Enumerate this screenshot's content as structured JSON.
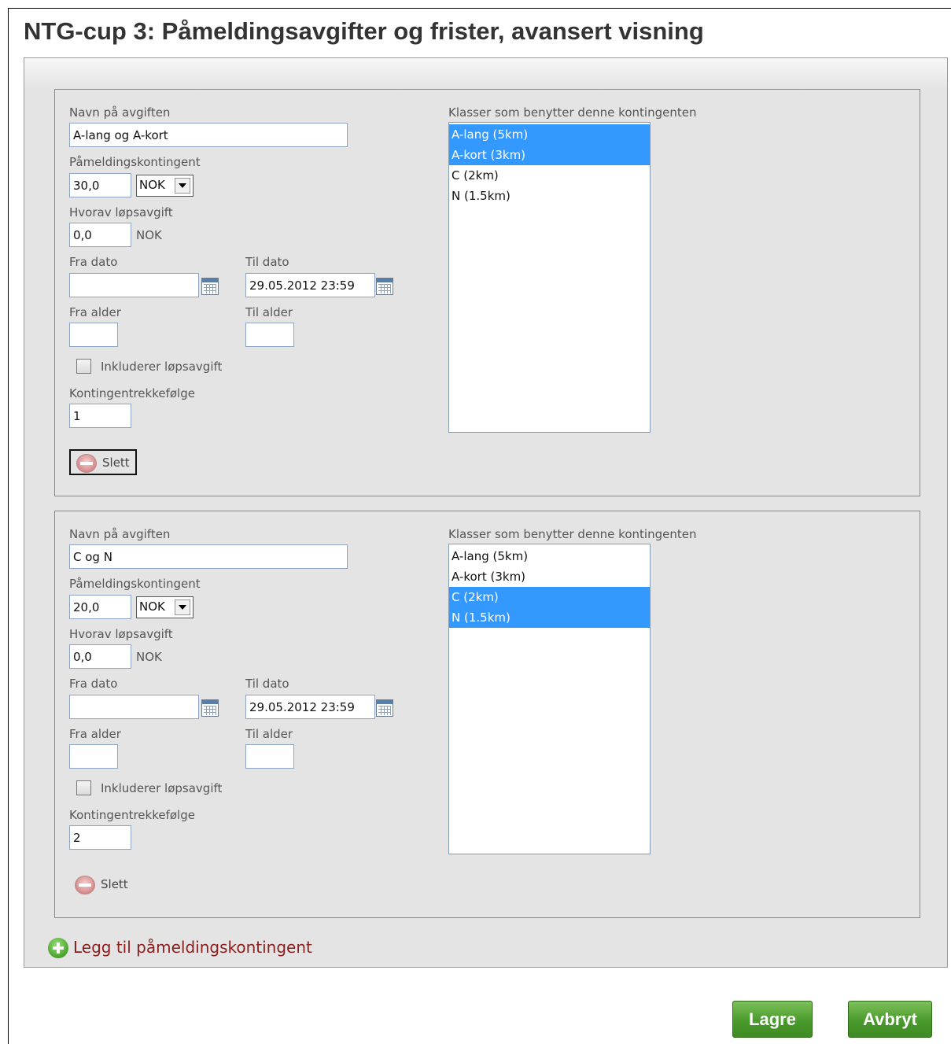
{
  "page": {
    "title": "NTG-cup 3: Påmeldingsavgifter og frister, avansert visning"
  },
  "labels": {
    "fee_name": "Navn på avgiften",
    "entry_fee": "Påmeldingskontingent",
    "of_which_race_fee": "Hvorav løpsavgift",
    "from_date": "Fra dato",
    "to_date": "Til dato",
    "from_age": "Fra alder",
    "to_age": "Til alder",
    "includes_race_fee": "Inkluderer løpsavgift",
    "fee_order": "Kontingentrekkefølge",
    "classes": "Klasser som benytter denne kontingenten",
    "delete": "Slett",
    "currency_unit": "NOK"
  },
  "fees": [
    {
      "name": "A-lang og A-kort",
      "amount": "30,0",
      "currency": "NOK",
      "race_fee": "0,0",
      "from_date": "",
      "to_date": "29.05.2012 23:59",
      "from_age": "",
      "to_age": "",
      "includes_race_fee": false,
      "order": "1",
      "classes": [
        {
          "label": "A-lang (5km)",
          "selected": true
        },
        {
          "label": "A-kort (3km)",
          "selected": true
        },
        {
          "label": "C (2km)",
          "selected": false
        },
        {
          "label": "N (1.5km)",
          "selected": false
        }
      ]
    },
    {
      "name": "C og N",
      "amount": "20,0",
      "currency": "NOK",
      "race_fee": "0,0",
      "from_date": "",
      "to_date": "29.05.2012 23:59",
      "from_age": "",
      "to_age": "",
      "includes_race_fee": false,
      "order": "2",
      "classes": [
        {
          "label": "A-lang (5km)",
          "selected": false
        },
        {
          "label": "A-kort (3km)",
          "selected": false
        },
        {
          "label": "C (2km)",
          "selected": true
        },
        {
          "label": "N (1.5km)",
          "selected": true
        }
      ]
    }
  ],
  "actions": {
    "add_fee": "Legg til påmeldingskontingent",
    "save": "Lagre",
    "cancel": "Avbryt"
  }
}
